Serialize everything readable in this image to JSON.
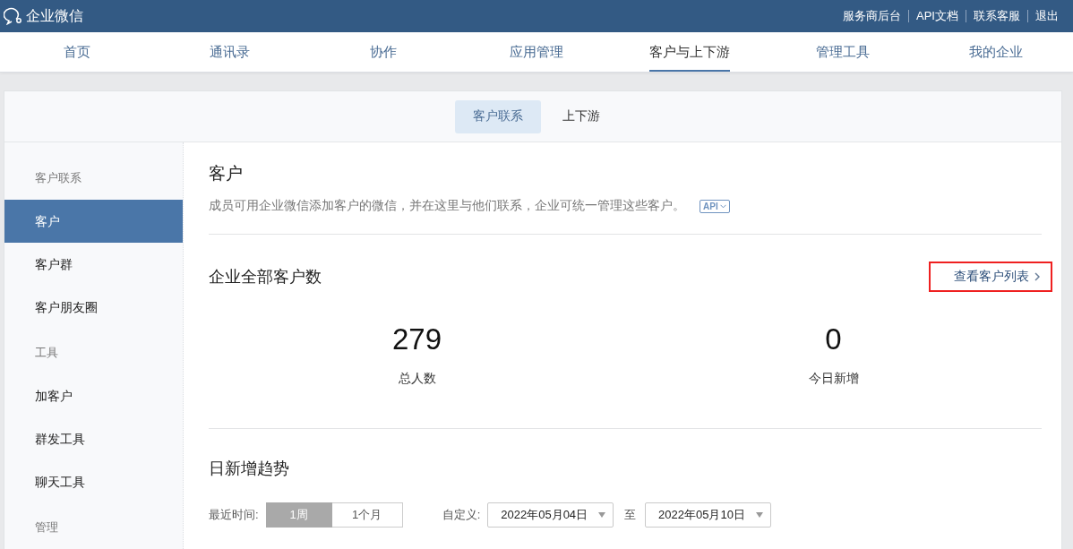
{
  "topbar": {
    "logo": "企业微信",
    "links": [
      "服务商后台",
      "API文档",
      "联系客服",
      "退出"
    ]
  },
  "nav": [
    {
      "label": "首页",
      "selected": false
    },
    {
      "label": "通讯录",
      "selected": false
    },
    {
      "label": "协作",
      "selected": false
    },
    {
      "label": "应用管理",
      "selected": false
    },
    {
      "label": "客户与上下游",
      "selected": true
    },
    {
      "label": "管理工具",
      "selected": false
    },
    {
      "label": "我的企业",
      "selected": false
    }
  ],
  "subtabs": [
    {
      "label": "客户联系",
      "selected": true
    },
    {
      "label": "上下游",
      "selected": false
    }
  ],
  "sidebar": {
    "items": [
      {
        "kind": "header",
        "label": "客户联系"
      },
      {
        "kind": "item",
        "label": "客户",
        "selected": true
      },
      {
        "kind": "item",
        "label": "客户群",
        "selected": false
      },
      {
        "kind": "item",
        "label": "客户朋友圈",
        "selected": false
      },
      {
        "kind": "header",
        "label": "工具"
      },
      {
        "kind": "item",
        "label": "加客户",
        "selected": false
      },
      {
        "kind": "item",
        "label": "群发工具",
        "selected": false
      },
      {
        "kind": "item",
        "label": "聊天工具",
        "selected": false
      },
      {
        "kind": "header",
        "label": "管理"
      }
    ]
  },
  "content": {
    "title": "客户",
    "description": "成员可用企业微信添加客户的微信，并在这里与他们联系，企业可统一管理这些客户。",
    "api_badge": "API",
    "total_section": {
      "title": "企业全部客户数",
      "link": {
        "label": "查看客户列表",
        "highlighted": true
      },
      "stats": [
        {
          "value": "279",
          "label": "总人数"
        },
        {
          "value": "0",
          "label": "今日新增"
        }
      ]
    },
    "trend_section": {
      "title": "日新增趋势",
      "recent_label": "最近时间:",
      "ranges": [
        {
          "label": "1周",
          "selected": true
        },
        {
          "label": "1个月",
          "selected": false
        }
      ],
      "custom_label": "自定义:",
      "start_date": "2022年05月04日",
      "to_label": "至",
      "end_date": "2022年05月10日"
    }
  }
}
